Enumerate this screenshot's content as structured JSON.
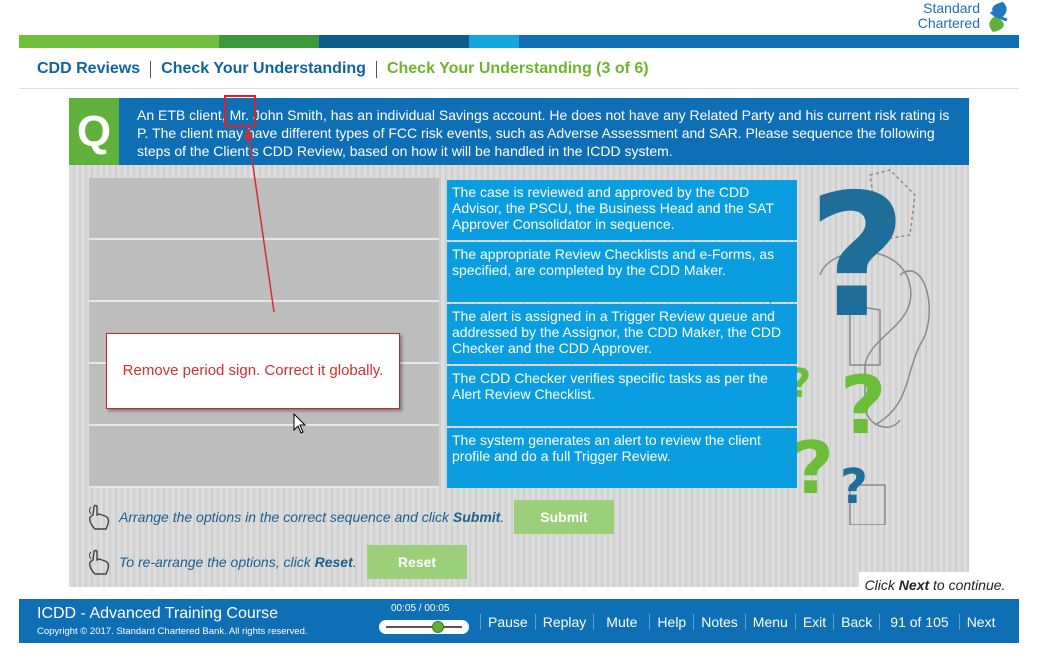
{
  "brand": {
    "logo_line1": "Standard",
    "logo_line2": "Chartered"
  },
  "breadcrumb": {
    "item1": "CDD Reviews",
    "item2": "Check Your Understanding",
    "current": "Check Your Understanding (3 of 6)"
  },
  "question": {
    "badge": "Q",
    "text": "An ETB client, Mr. John Smith, has an individual Savings account. He does not have any Related Party and his current risk rating is P. The client may have different types of FCC risk events, such as Adverse Assessment and SAR. Please sequence the following steps of the Client's CDD Review, based on how it will be handled in the ICDD system."
  },
  "options": [
    "The case is reviewed and approved by the CDD Advisor, the PSCU, the Business Head and the SAT Approver Consolidator in sequence.",
    "The appropriate Review Checklists and e-Forms, as specified, are completed by the CDD Maker.",
    "The alert is assigned in a Trigger Review queue and addressed by the Assignor, the CDD Maker, the CDD Checker and the CDD Approver.",
    "The CDD Checker verifies specific tasks as per the Alert Review Checklist.",
    "The system generates an alert to review the client profile and do a full Trigger Review."
  ],
  "instructions": {
    "submit_text": "Arrange the options in the correct sequence and click ",
    "submit_word": "Submit",
    "submit_end": ".",
    "reset_text": "To re-arrange the options, click ",
    "reset_word": "Reset",
    "reset_end": "."
  },
  "buttons": {
    "submit": "Submit",
    "reset": "Reset"
  },
  "next_hint": {
    "pre": "Click ",
    "word": "Next",
    "post": " to continue."
  },
  "annotation": {
    "comment": "Remove period sign. Correct it globally."
  },
  "footer": {
    "course_title": "ICDD - Advanced Training Course",
    "copyright": "Copyright © 2017. Standard Chartered Bank. All rights reserved.",
    "time": "00:05 / 00:05",
    "progress": 1.0,
    "nav": {
      "pause": "Pause",
      "replay": "Replay",
      "mute": "Mute",
      "help": "Help",
      "notes": "Notes",
      "menu": "Menu",
      "exit": "Exit",
      "back": "Back",
      "page": "91 of 105",
      "next": "Next"
    }
  },
  "colors": {
    "primary_blue": "#0e6fb5",
    "option_blue": "#0a9ee0",
    "green": "#5fb13b",
    "button_green": "#9ccf7a",
    "annotation_red": "#d32f2f",
    "color_bar": [
      "#6fbf3a",
      "#3d9a3a",
      "#0b5d8c",
      "#14a4e0",
      "#0e6fb5"
    ]
  }
}
